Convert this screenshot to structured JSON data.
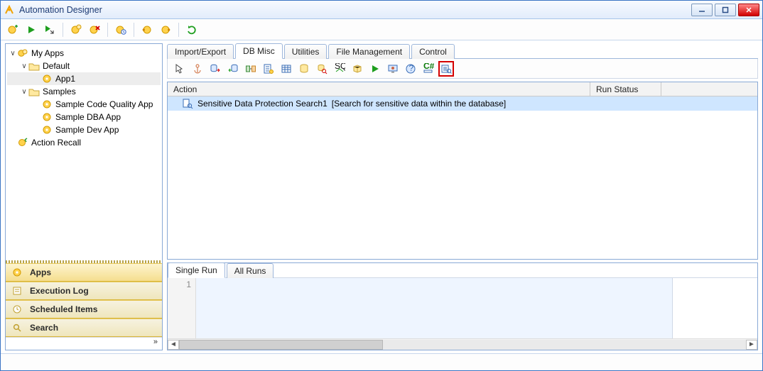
{
  "window": {
    "title": "Automation Designer"
  },
  "tree": {
    "root": "My Apps",
    "default_folder": "Default",
    "app1": "App1",
    "samples_folder": "Samples",
    "samples": [
      "Sample Code Quality App",
      "Sample DBA App",
      "Sample Dev App"
    ],
    "action_recall": "Action Recall"
  },
  "nav": {
    "apps": "Apps",
    "execution_log": "Execution Log",
    "scheduled_items": "Scheduled Items",
    "search": "Search"
  },
  "tabs": {
    "top": [
      "Import/Export",
      "DB Misc",
      "Utilities",
      "File Management",
      "Control"
    ],
    "active_top_index": 1,
    "log": [
      "Single Run",
      "All Runs"
    ],
    "active_log_index": 0
  },
  "grid": {
    "columns": {
      "action": "Action",
      "run_status": "Run Status"
    },
    "col_widths": {
      "action": 595,
      "run_status": 100
    },
    "row": {
      "name": "Sensitive Data Protection Search1",
      "desc": "[Search for sensitive data within the database]"
    }
  },
  "log": {
    "line_no": "1"
  }
}
